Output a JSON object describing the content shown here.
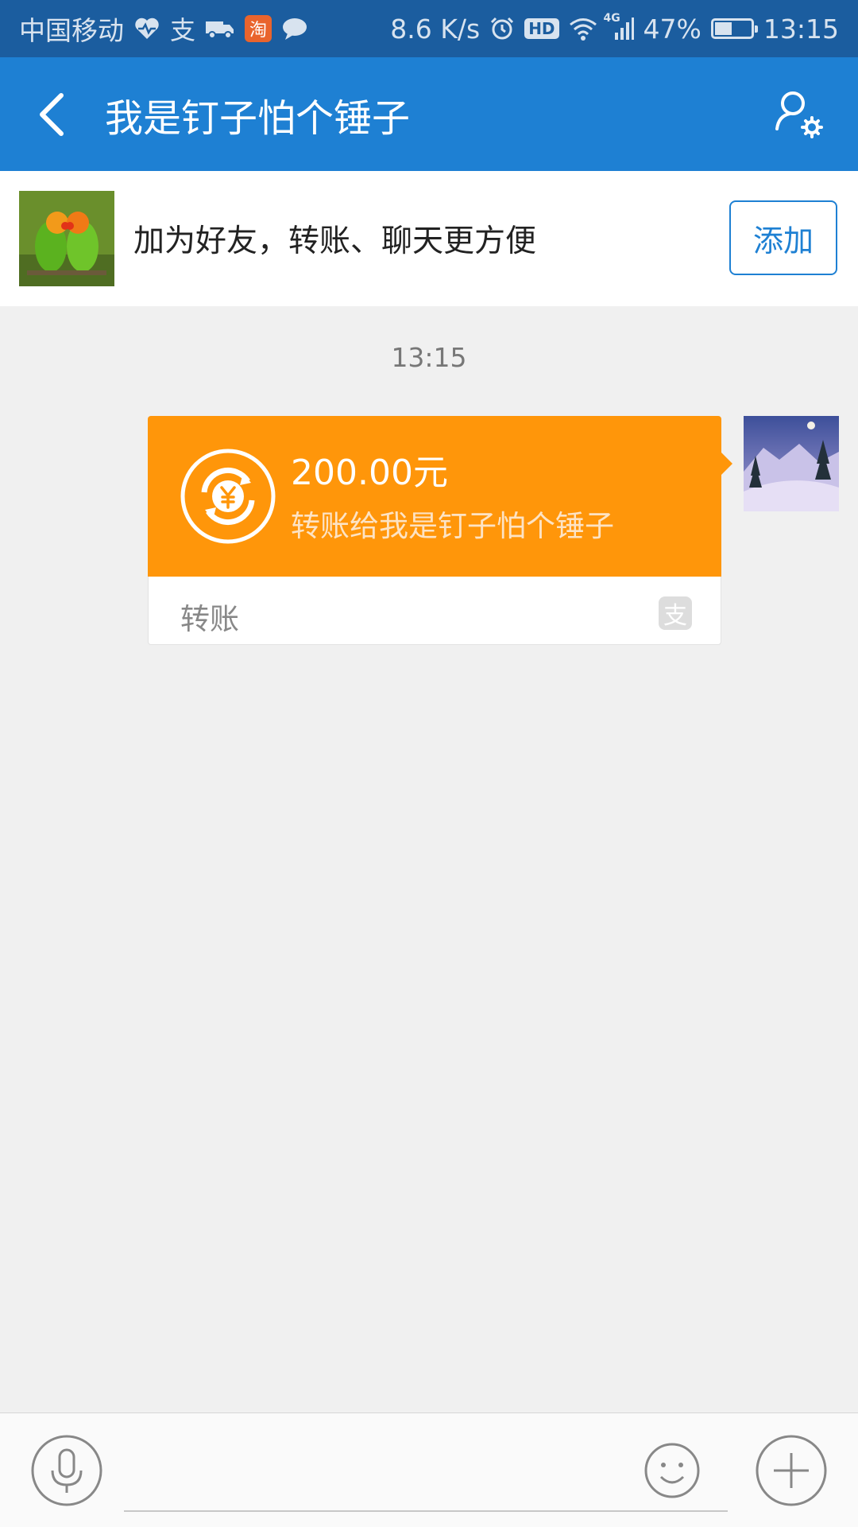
{
  "status_bar": {
    "carrier": "中国移动",
    "taobao_glyph": "淘",
    "alipay_glyph": "支",
    "network_speed": "8.6 K/s",
    "hd_label": "HD",
    "network_type": "4G",
    "battery_percent": "47%",
    "battery_level": 0.47,
    "time": "13:15",
    "icons": [
      "heart-rate-icon",
      "alipay-icon",
      "delivery-truck-icon",
      "taobao-icon",
      "message-bubble-icon",
      "alarm-icon",
      "hd-icon",
      "wifi-icon",
      "signal-icon",
      "battery-icon"
    ]
  },
  "header": {
    "title": "我是钉子怕个锤子",
    "back_icon": "chevron-left-icon",
    "profile_icon": "user-settings-icon",
    "background": "#1e80d3"
  },
  "friend_banner": {
    "text": "加为好友，转账、聊天更方便",
    "add_label": "添加"
  },
  "chat": {
    "timestamp": "13:15",
    "transfer": {
      "amount": "200.00元",
      "description": "转账给我是钉子怕个锤子",
      "footer_label": "转账",
      "footer_glyph": "支",
      "card_color": "#ff960a"
    }
  },
  "input_bar": {
    "placeholder": "",
    "icons": [
      "microphone-icon",
      "emoji-icon",
      "plus-icon"
    ]
  }
}
